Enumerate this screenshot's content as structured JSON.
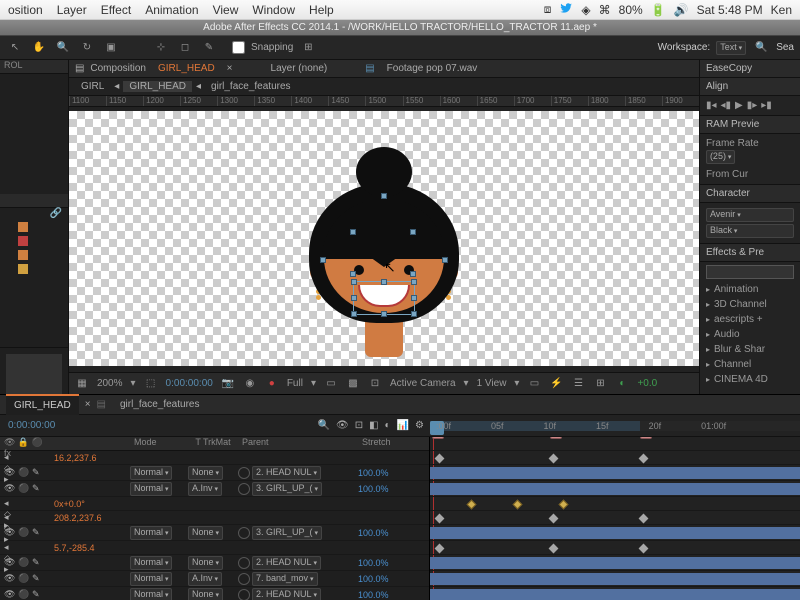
{
  "mac_menu": [
    "osition",
    "Layer",
    "Effect",
    "Animation",
    "View",
    "Window",
    "Help"
  ],
  "mac_status": {
    "battery": "80%",
    "time": "Sat 5:48 PM",
    "user": "Ken"
  },
  "titlebar": "Adobe After Effects CC 2014.1 - /WORK/HELLO TRACTOR/HELLO_TRACTOR 11.aep *",
  "snapping_label": "Snapping",
  "workspace": {
    "label": "Workspace:",
    "value": "Text",
    "search": "Sea"
  },
  "left_panel_title": "ROL",
  "comp_panel": {
    "prefix": "Composition",
    "name": "GIRL_HEAD",
    "layer_tab": "Layer (none)",
    "footage_tab": "Footage pop 07.wav"
  },
  "breadcrumbs": [
    "GIRL",
    "GIRL_HEAD",
    "girl_face_features"
  ],
  "ruler_marks": [
    "1100",
    "1150",
    "1200",
    "1250",
    "1300",
    "1350",
    "1400",
    "1450",
    "1500",
    "1550",
    "1600",
    "1650",
    "1700",
    "1750",
    "1800",
    "1850",
    "1900"
  ],
  "viewer": {
    "zoom": "200%",
    "timecode": "0:00:00:00",
    "res": "Full",
    "camera": "Active Camera",
    "views": "1 View",
    "exposure": "+0.0"
  },
  "right_panels": {
    "ease": "EaseCopy",
    "align": "Align",
    "preview": {
      "title": "RAM Previe",
      "fr_label": "Frame Rate",
      "fr_value": "(25)",
      "note": "From Cur"
    },
    "char": {
      "title": "Character",
      "font": "Avenir",
      "style": "Black"
    },
    "fx": {
      "title": "Effects & Pre",
      "items": [
        "Animation",
        "3D Channel",
        "aescripts +",
        "Audio",
        "Blur & Shar",
        "Channel",
        "CINEMA 4D"
      ]
    }
  },
  "timeline_tabs": [
    "GIRL_HEAD",
    "girl_face_features"
  ],
  "tl_timecode": "0:00:00:00",
  "tl_ruler": [
    ":00f",
    "05f",
    "10f",
    "15f",
    "20f",
    "01:00f"
  ],
  "markers": [
    "1",
    "2",
    "3"
  ],
  "columns": {
    "mode": "Mode",
    "trk": "TrkMat",
    "parent": "Parent",
    "stretch": "Stretch"
  },
  "layers": [
    {
      "prop": true,
      "name": "16.2,237.6"
    },
    {
      "mode": "Normal",
      "trk": "None",
      "parent": "2. HEAD NUL",
      "stretch": "100.0%"
    },
    {
      "mode": "Normal",
      "trk": "A.Inv",
      "parent": "3. GIRL_UP_(",
      "stretch": "100.0%"
    },
    {
      "prop": true,
      "name": "0x+0.0°"
    },
    {
      "prop": true,
      "name": "208.2,237.6"
    },
    {
      "mode": "Normal",
      "trk": "None",
      "parent": "3. GIRL_UP_(",
      "stretch": "100.0%"
    },
    {
      "prop": true,
      "name": "5.7,-285.4"
    },
    {
      "mode": "Normal",
      "trk": "None",
      "parent": "2. HEAD NUL",
      "stretch": "100.0%"
    },
    {
      "mode": "Normal",
      "trk": "A.Inv",
      "parent": "7. band_mov",
      "stretch": "100.0%"
    },
    {
      "mode": "Normal",
      "trk": "None",
      "parent": "2. HEAD NUL",
      "stretch": "100.0%"
    }
  ]
}
